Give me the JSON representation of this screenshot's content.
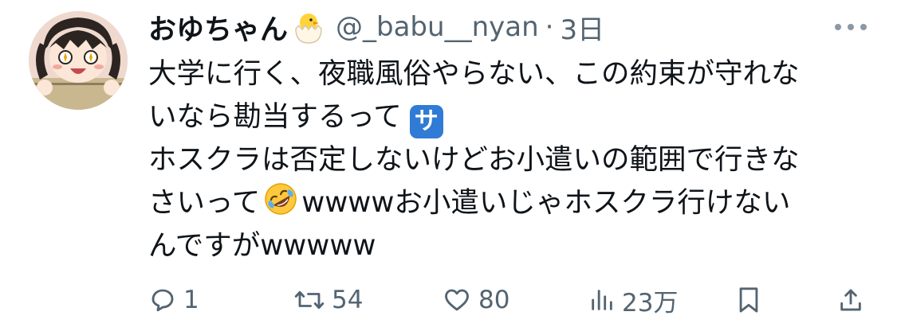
{
  "tweet": {
    "display_name": "おゆちゃん",
    "name_emoji": "hatching-chick-icon",
    "handle": "@_babu__nyan",
    "separator": "·",
    "timestamp": "3日",
    "more_icon": "more-horizontal-icon",
    "lines": {
      "l1": "大学に行く、夜職風俗やらない、この約束が守れな",
      "l2": "いなら勘当するって",
      "l3": "ホスクラは否定しないけどお小遣いの範囲で行きな",
      "l4a": "さいって",
      "l4b": "wwwwお小遣いじゃホスクラ行けない",
      "l5": "んですがwwwww"
    },
    "sa_emoji_label": "サ",
    "laugh_emoji": "rolling-on-floor-laughing-icon",
    "actions": {
      "replies": "1",
      "reposts": "54",
      "likes": "80",
      "views": "23万"
    },
    "colors": {
      "text": "#0f1419",
      "secondary": "#536471",
      "sa_badge": "#2f7bd6"
    }
  }
}
